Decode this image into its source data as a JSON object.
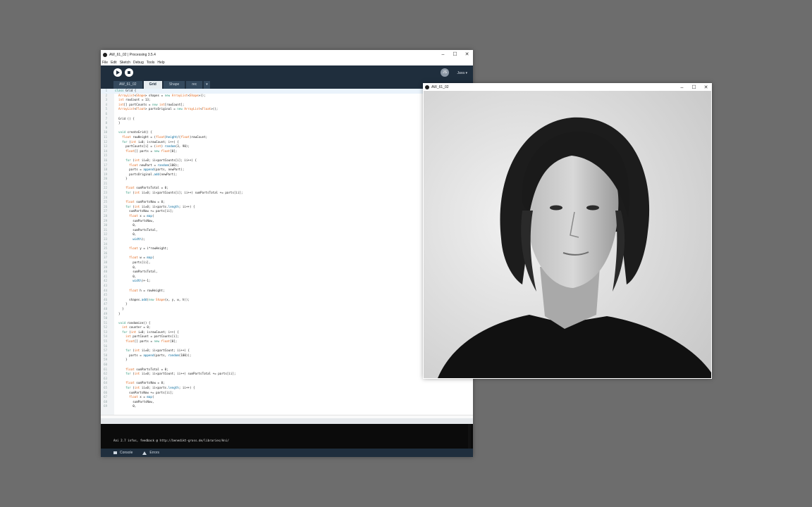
{
  "processing_window": {
    "title": "AW_61_02 | Processing 3.5.4",
    "menu": [
      "File",
      "Edit",
      "Sketch",
      "Debug",
      "Tools",
      "Help"
    ],
    "mode_badge": "JS",
    "mode_label": "Java ▾",
    "tabs": [
      {
        "label": "AW_61_02",
        "active": false
      },
      {
        "label": "Grid",
        "active": true
      },
      {
        "label": "Shape",
        "active": false
      },
      {
        "label": "rec",
        "active": false
      }
    ],
    "tab_overflow": "▾",
    "code_lines": [
      {
        "n": "1",
        "t": "class Grid {"
      },
      {
        "n": "2",
        "t": "  ArrayList<Shape> shapes = new ArrayList<Shape>();"
      },
      {
        "n": "3",
        "t": "  int rowCount = 13;"
      },
      {
        "n": "4",
        "t": "  int[] partCounts = new int[rowCount];"
      },
      {
        "n": "5",
        "t": "  ArrayList<Float> partsOriginal = new ArrayList<Float>();"
      },
      {
        "n": "6",
        "t": ""
      },
      {
        "n": "7",
        "t": "  Grid () {"
      },
      {
        "n": "8",
        "t": "  }"
      },
      {
        "n": "9",
        "t": ""
      },
      {
        "n": "10",
        "t": "  void createGrid() {"
      },
      {
        "n": "11",
        "t": "    float rowHeight = (float)height/(float)rowCount;"
      },
      {
        "n": "12",
        "t": "    for (int i=0; i<rowCount; i++) {"
      },
      {
        "n": "13",
        "t": "      partCounts[i] = (int) random(3, 90);"
      },
      {
        "n": "14",
        "t": "      float[] parts = new float[0];"
      },
      {
        "n": "15",
        "t": ""
      },
      {
        "n": "16",
        "t": "      for (int ii=0; ii<partCounts[i]; ii++) {"
      },
      {
        "n": "17",
        "t": "        float newPart = random(100);"
      },
      {
        "n": "18",
        "t": "        parts = append(parts, newPart);"
      },
      {
        "n": "19",
        "t": "        partsOriginal.add(newPart);"
      },
      {
        "n": "20",
        "t": "      }"
      },
      {
        "n": "21",
        "t": ""
      },
      {
        "n": "22",
        "t": "      float sumPartsTotal = 0;"
      },
      {
        "n": "23",
        "t": "      for (int ii=0; ii<partCounts[i]; ii++) sumPartsTotal += parts[ii];"
      },
      {
        "n": "24",
        "t": ""
      },
      {
        "n": "25",
        "t": "      float sumPartsNow = 0;"
      },
      {
        "n": "26",
        "t": "      for (int ii=0; ii<parts.length; ii++) {"
      },
      {
        "n": "27",
        "t": "        sumPartsNow += parts[ii];"
      },
      {
        "n": "28",
        "t": "        float x = map("
      },
      {
        "n": "29",
        "t": "          sumPartsNow,"
      },
      {
        "n": "30",
        "t": "          0,"
      },
      {
        "n": "31",
        "t": "          sumPartsTotal,"
      },
      {
        "n": "32",
        "t": "          0,"
      },
      {
        "n": "33",
        "t": "          width);"
      },
      {
        "n": "34",
        "t": ""
      },
      {
        "n": "35",
        "t": "        float y = i*rowHeight;"
      },
      {
        "n": "36",
        "t": ""
      },
      {
        "n": "37",
        "t": "        float w = map("
      },
      {
        "n": "38",
        "t": "          parts[ii],"
      },
      {
        "n": "39",
        "t": "          0,"
      },
      {
        "n": "40",
        "t": "          sumPartsTotal,"
      },
      {
        "n": "41",
        "t": "          0,"
      },
      {
        "n": "42",
        "t": "          width)+-1;"
      },
      {
        "n": "43",
        "t": ""
      },
      {
        "n": "44",
        "t": "        float h = rowHeight;"
      },
      {
        "n": "45",
        "t": ""
      },
      {
        "n": "46",
        "t": "        shapes.add(new Shape(x, y, w, h));"
      },
      {
        "n": "47",
        "t": "      }"
      },
      {
        "n": "48",
        "t": "    }"
      },
      {
        "n": "49",
        "t": "  }"
      },
      {
        "n": "50",
        "t": ""
      },
      {
        "n": "51",
        "t": "  void randomize() {"
      },
      {
        "n": "52",
        "t": "    int counter = 0;"
      },
      {
        "n": "53",
        "t": "    for (int i=0; i<rowCount; i++) {"
      },
      {
        "n": "54",
        "t": "      int partCount = partCounts[i];"
      },
      {
        "n": "55",
        "t": "      float[] parts = new float[0];"
      },
      {
        "n": "56",
        "t": ""
      },
      {
        "n": "57",
        "t": "      for (int ii=0; ii<partCount; ii++) {"
      },
      {
        "n": "58",
        "t": "        parts = append(parts, random(100));"
      },
      {
        "n": "59",
        "t": "      }"
      },
      {
        "n": "60",
        "t": ""
      },
      {
        "n": "61",
        "t": "      float sumPartsTotal = 0;"
      },
      {
        "n": "62",
        "t": "      for (int ii=0; ii<partCount; ii++) sumPartsTotal += parts[ii];"
      },
      {
        "n": "63",
        "t": ""
      },
      {
        "n": "64",
        "t": "      float sumPartsNow = 0;"
      },
      {
        "n": "65",
        "t": "      for (int ii=0; ii<parts.length; ii++) {"
      },
      {
        "n": "66",
        "t": "        sumPartsNow += parts[ii];"
      },
      {
        "n": "67",
        "t": "        float x = map("
      },
      {
        "n": "68",
        "t": "          sumPartsNow,"
      },
      {
        "n": "69",
        "t": "          0,"
      }
    ],
    "console_text": "Ani 2.7 infos, feedback @ http://benedikt-gross.de/libraries/Ani/",
    "bottom_tabs": [
      "Console",
      "Errors"
    ]
  },
  "sketch_window": {
    "title": "AW_61_02"
  },
  "colors": {
    "desktop": "#6d6d6d",
    "toolbar": "#1f2e3d",
    "keyword": "#33997e",
    "type": "#e2661a",
    "function": "#006699"
  }
}
